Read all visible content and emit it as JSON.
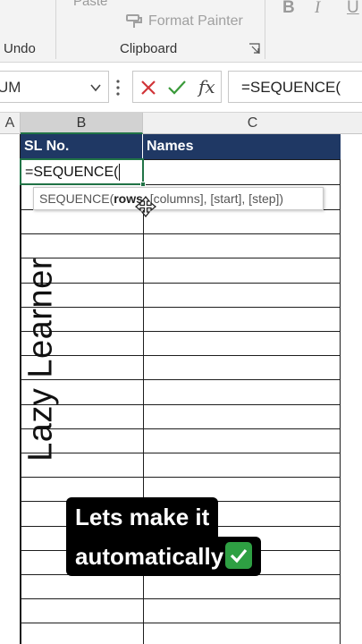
{
  "ribbon": {
    "paste_label": "Paste",
    "format_painter_label": "Format Painter",
    "undo_group": "Undo",
    "clipboard_group": "Clipboard",
    "font_buttons": [
      "B",
      "I",
      "U"
    ]
  },
  "formula_bar": {
    "name_box_value": "UM",
    "formula_text": "=SEQUENCE(",
    "fx_label": "fx"
  },
  "columns": [
    "A",
    "B",
    "C"
  ],
  "table": {
    "headers": [
      "SL No.",
      "Names"
    ]
  },
  "active_cell": {
    "text": "=SEQUENCE("
  },
  "tooltip": {
    "fn": "SEQUENCE(",
    "arg_bold": "rows",
    "rest": ", [columns], [start], [step])"
  },
  "watermark": "Lazy Learner",
  "caption": {
    "line1": "Lets make it",
    "line2": "automatically"
  },
  "colors": {
    "header_fill": "#1f3864",
    "accent_green": "#217346",
    "check_green": "#2ea043"
  }
}
